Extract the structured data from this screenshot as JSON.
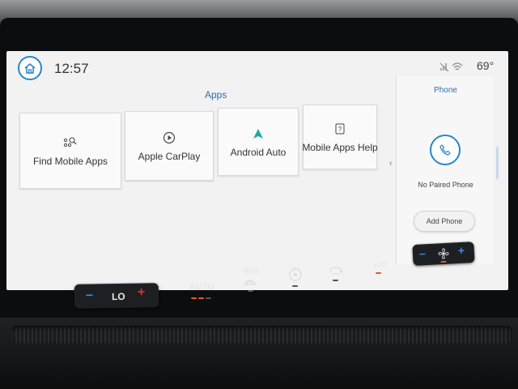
{
  "topbar": {
    "time": "12:57",
    "temperature": "69°",
    "icons": [
      "home-icon",
      "no-signal-icon",
      "wifi-icon"
    ]
  },
  "apps": {
    "title": "Apps",
    "tiles": [
      {
        "label": "Find Mobile Apps",
        "icon": "search-apps-icon"
      },
      {
        "label": "Apple CarPlay",
        "icon": "carplay-icon"
      },
      {
        "label": "Android Auto",
        "icon": "android-auto-icon",
        "icon_color": "#1fa7a0"
      },
      {
        "label": "Mobile Apps Help",
        "icon": "help-icon"
      }
    ]
  },
  "phone": {
    "title": "Phone",
    "status": "No Paired Phone",
    "add_label": "Add Phone",
    "icon": "phone-icon"
  },
  "climate": {
    "driver_temp": "LO",
    "auto_label": "AUTO",
    "max_label": "MAX",
    "ac_label": "A/C",
    "icons": [
      "max-defrost-icon",
      "heated-steering-icon",
      "recirculation-icon",
      "fan-icon"
    ]
  },
  "colors": {
    "accent": "#2b86c9",
    "screen_bg": "#f1f2f1",
    "indicator_on": "#e45a2a",
    "minus_blue": "#3a8ee6",
    "plus_red": "#e03030"
  }
}
